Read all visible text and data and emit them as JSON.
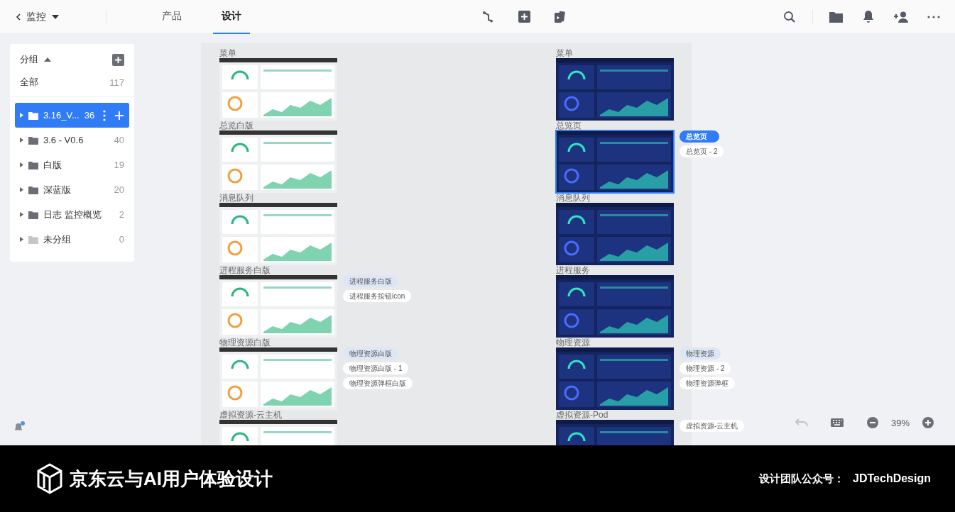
{
  "topbar": {
    "back_label": "监控",
    "tabs": [
      {
        "label": "产品",
        "selected": false
      },
      {
        "label": "设计",
        "selected": true
      }
    ]
  },
  "sidebar": {
    "header": {
      "label": "分组",
      "expanded": true
    },
    "all": {
      "label": "全部",
      "count": "117"
    },
    "groups": [
      {
        "name": "3.16_V...",
        "count": "36",
        "selected": true,
        "dimmed": false
      },
      {
        "name": "3.6 - V0.6",
        "count": "40",
        "selected": false,
        "dimmed": false
      },
      {
        "name": "白版",
        "count": "19",
        "selected": false,
        "dimmed": false
      },
      {
        "name": "深蓝版",
        "count": "20",
        "selected": false,
        "dimmed": false
      },
      {
        "name": "日志 监控概览",
        "count": "2",
        "selected": false,
        "dimmed": false
      },
      {
        "name": "未分组",
        "count": "0",
        "selected": false,
        "dimmed": true
      }
    ]
  },
  "canvas": {
    "columns": [
      {
        "items": [
          {
            "label": "菜单",
            "kind": "light",
            "selected": false
          },
          {
            "label": "总览白版",
            "kind": "light",
            "selected": false
          },
          {
            "label": "消息队列",
            "kind": "light",
            "selected": false
          },
          {
            "label": "进程服务白版",
            "kind": "light",
            "selected": false,
            "chips": [
              {
                "label": "进程服务白版",
                "selected": false,
                "highlighted": true
              },
              {
                "label": "进程服务按钮icon",
                "selected": false,
                "highlighted": false
              }
            ]
          },
          {
            "label": "物理资源白版",
            "kind": "light",
            "selected": false,
            "chips": [
              {
                "label": "物理资源白版",
                "selected": false,
                "highlighted": true
              },
              {
                "label": "物理资源白版 - 1",
                "selected": false,
                "highlighted": false
              },
              {
                "label": "物理资源弹框白版",
                "selected": false,
                "highlighted": false
              }
            ]
          },
          {
            "label": "虚拟资源-云主机",
            "kind": "light",
            "selected": false
          }
        ]
      },
      {
        "items": [
          {
            "label": "菜单",
            "kind": "dark",
            "selected": false
          },
          {
            "label": "总览页",
            "kind": "dark",
            "selected": true,
            "chips": [
              {
                "label": "总览页",
                "selected": true,
                "highlighted": false
              },
              {
                "label": "总览页 - 2",
                "selected": false,
                "highlighted": false
              }
            ]
          },
          {
            "label": "消息队列",
            "kind": "dark",
            "selected": false
          },
          {
            "label": "进程服务",
            "kind": "dark",
            "selected": false
          },
          {
            "label": "物理资源",
            "kind": "dark",
            "selected": false,
            "chips": [
              {
                "label": "物理资源",
                "selected": false,
                "highlighted": true
              },
              {
                "label": "物理资源 - 2",
                "selected": false,
                "highlighted": false
              },
              {
                "label": "物理资源弹框",
                "selected": false,
                "highlighted": false
              }
            ]
          },
          {
            "label": "虚拟资源-Pod",
            "kind": "dark",
            "selected": false,
            "chips": [
              {
                "label": "虚拟资源-云主机",
                "selected": false,
                "highlighted": false
              }
            ]
          }
        ]
      }
    ]
  },
  "zoom": {
    "value": "39%"
  },
  "footer": {
    "brand": "京东云与AI用户体验设计",
    "account_label": "设计团队公众号：",
    "account": "JDTechDesign"
  }
}
